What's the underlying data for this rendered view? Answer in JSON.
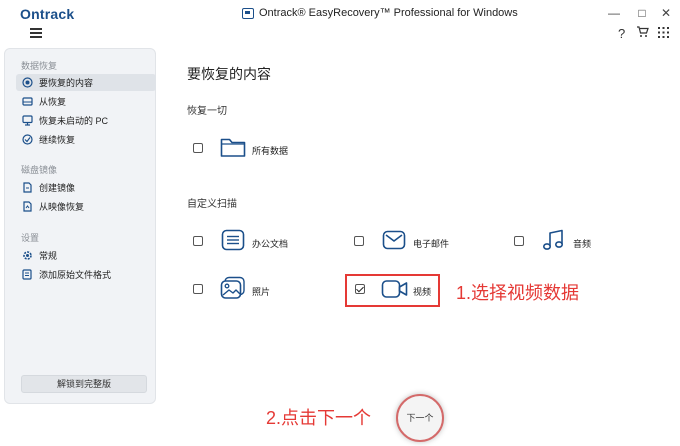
{
  "app": {
    "logo": "Ontrack",
    "window_title": "Ontrack® EasyRecovery™ Professional for Windows"
  },
  "window_controls": {
    "minimize": "—",
    "maximize": "□",
    "close": "✕"
  },
  "toolbar": {
    "help": "?",
    "cart": "🛒",
    "grid": "⋮⋮⋮"
  },
  "sidebar": {
    "sections": [
      {
        "title": "数据恢复"
      },
      {
        "title": "磁盘镜像"
      },
      {
        "title": "设置"
      }
    ],
    "items": [
      {
        "label": "要恢复的内容",
        "icon": "target-icon",
        "active": true
      },
      {
        "label": "从恢复",
        "icon": "drive-icon"
      },
      {
        "label": "恢复未启动的 PC",
        "icon": "monitor-icon"
      },
      {
        "label": "继续恢复",
        "icon": "resume-icon"
      },
      {
        "label": "创建镜像",
        "icon": "create-image-icon"
      },
      {
        "label": "从映像恢复",
        "icon": "restore-image-icon"
      },
      {
        "label": "常规",
        "icon": "gear-icon"
      },
      {
        "label": "添加原始文件格式",
        "icon": "add-file-format-icon"
      }
    ],
    "unlock_button": "解锁到完整版"
  },
  "main": {
    "title": "要恢复的内容",
    "recover_all": {
      "heading": "恢复一切",
      "option": {
        "label": "所有数据",
        "checked": false,
        "icon": "folder-icon"
      }
    },
    "custom_scan": {
      "heading": "自定义扫描",
      "options": [
        {
          "label": "办公文档",
          "checked": false,
          "icon": "document-icon"
        },
        {
          "label": "电子邮件",
          "checked": false,
          "icon": "email-icon"
        },
        {
          "label": "音频",
          "checked": false,
          "icon": "music-icon"
        },
        {
          "label": "照片",
          "checked": false,
          "icon": "photo-icon"
        },
        {
          "label": "视频",
          "checked": true,
          "icon": "video-icon"
        }
      ]
    }
  },
  "annotations": {
    "step1": "1.选择视频数据",
    "step2": "2.点击下一个"
  },
  "next_button": "下一个",
  "colors": {
    "accent": "#1b4f8a",
    "annotation_red": "#e53935"
  }
}
